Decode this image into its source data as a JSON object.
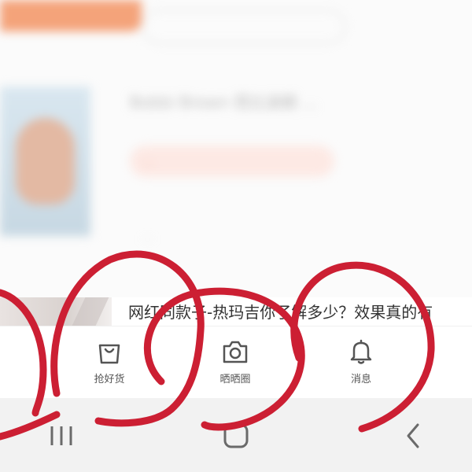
{
  "background": {
    "blurred_title": "Bobbi Brown 芭比波朗 …",
    "blurred_tag": "…",
    "blurred_meta": "…"
  },
  "article": {
    "title": "网红同款子-热玛吉你了解多少？效果真的有"
  },
  "tabbar": {
    "items": [
      {
        "label": "抢好货",
        "icon": "shopping-bag-icon"
      },
      {
        "label": "晒晒圈",
        "icon": "camera-icon"
      },
      {
        "label": "消息",
        "icon": "bell-icon"
      }
    ]
  },
  "navbar": {
    "recents_icon": "recents-icon",
    "home_icon": "home-icon",
    "back_icon": "back-chevron-icon"
  },
  "colors": {
    "scribble": "#cc1f33",
    "tab_icon": "#555555",
    "nav_icon": "#6a6a6a",
    "accent_orange": "#f4a37a"
  }
}
